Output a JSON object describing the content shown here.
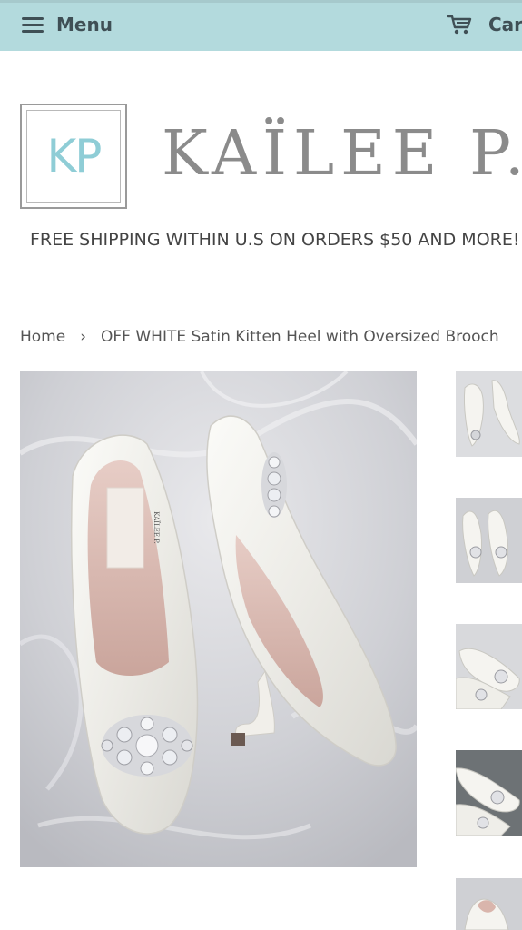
{
  "header": {
    "menu_label": "Menu",
    "cart_label": "Cart",
    "bar_color": "#b3dadd",
    "icons": {
      "menu": "hamburger-icon",
      "cart": "cart-icon"
    }
  },
  "brand": {
    "initials": "KP",
    "name": "KAÏLEE P.",
    "accent_color": "#8fcdd6"
  },
  "promo_banner": "FREE SHIPPING WITHIN U.S ON ORDERS $50 AND MORE!",
  "breadcrumb": {
    "home": "Home",
    "separator": "›",
    "current": "OFF WHITE Satin Kitten Heel with Oversized Brooch"
  },
  "product": {
    "insole_label": "KAÏLEE P."
  }
}
